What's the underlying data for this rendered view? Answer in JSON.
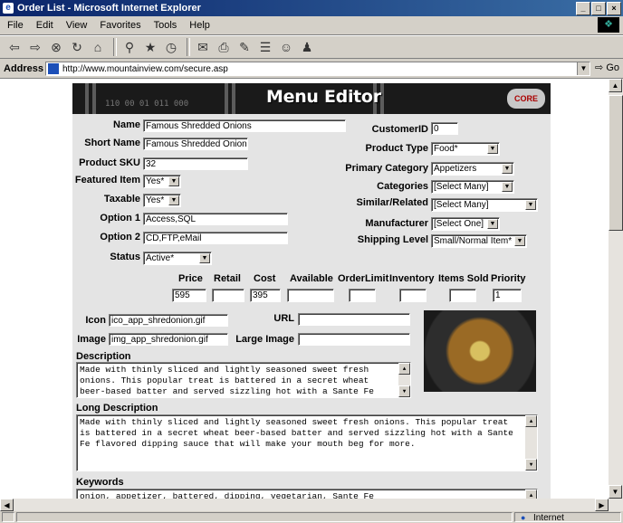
{
  "window": {
    "title": "Order List - Microsoft Internet Explorer"
  },
  "menu": [
    "File",
    "Edit",
    "View",
    "Favorites",
    "Tools",
    "Help"
  ],
  "address": {
    "label": "Address",
    "url": "http://www.mountainview.com/secure.asp",
    "go": "Go"
  },
  "editor": {
    "banner_title": "Menu Editor",
    "banner_digits": "110 00 01 011 000",
    "banner_logo": "CORE WEB",
    "labels": {
      "name": "Name",
      "short_name": "Short Name",
      "product_sku": "Product SKU",
      "featured": "Featured Item",
      "taxable": "Taxable",
      "option1": "Option 1",
      "option2": "Option 2",
      "status": "Status",
      "customer_id": "CustomerID",
      "product_type": "Product Type",
      "primary_category": "Primary Category",
      "categories": "Categories",
      "similar": "Similar/Related",
      "manufacturer": "Manufacturer",
      "shipping_level": "Shipping Level",
      "icon": "Icon",
      "image": "Image",
      "url": "URL",
      "large_image": "Large Image",
      "description": "Description",
      "long_description": "Long Description",
      "keywords": "Keywords"
    },
    "values": {
      "name": "Famous Shredded Onions",
      "short_name": "Famous Shredded Onion",
      "product_sku": "32",
      "featured": "Yes*",
      "taxable": "Yes*",
      "option1": "Access,SQL",
      "option2": "CD,FTP,eMail",
      "status": "Active*",
      "customer_id": "0",
      "product_type": "Food*",
      "primary_category": "Appetizers",
      "categories": "[Select Many]",
      "similar": "[Select Many]",
      "manufacturer": "[Select One]",
      "shipping_level": "Small/Normal Item*",
      "icon": "ico_app_shredonion.gif",
      "image": "img_app_shredonion.gif",
      "url": "",
      "large_image": ""
    },
    "pricing": {
      "headers": [
        "Price",
        "Retail",
        "Cost",
        "Available",
        "OrderLimit",
        "Inventory",
        "Items Sold",
        "Priority"
      ],
      "values": [
        "595",
        "",
        "395",
        "",
        "",
        "",
        "",
        "1"
      ]
    },
    "description": "Made with thinly sliced and lightly seasoned sweet fresh onions.  This popular treat is battered in a secret wheat beer-based batter and served sizzling hot with a Sante Fe",
    "long_description": "Made with thinly sliced and lightly seasoned sweet fresh onions.  This popular treat is battered in a secret wheat beer-based batter and served sizzling hot with a Sante Fe flavored dipping sauce that will make your mouth beg for more.",
    "keywords": "onion, appetizer, battered, dipping, vegetarian, Sante Fe"
  },
  "status": {
    "zone": "Internet"
  }
}
